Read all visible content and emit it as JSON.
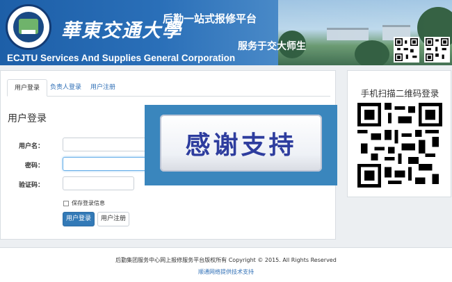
{
  "header": {
    "university_name": "華東交通大學",
    "corporation_name": "ECJTU Services And Supplies General Corporation",
    "system_title": "后勤一站式报修平台",
    "slogan": "服务于交大师生"
  },
  "login": {
    "tabs": [
      {
        "label": "用户登录",
        "active": true
      },
      {
        "label": "负责人登录",
        "active": false
      },
      {
        "label": "用户注册",
        "active": false
      }
    ],
    "heading": "用户登录",
    "username_label": "用户名：",
    "password_label": "密码：",
    "captcha_label": "验证码：",
    "remember_label": "保存登录信息",
    "login_button": "用户登录",
    "register_button": "用户注册"
  },
  "overlay": {
    "text": "感谢支持"
  },
  "qr": {
    "title": "手机扫描二维码登录"
  },
  "footer": {
    "copyright": "后勤集团服务中心网上报修服务平台版权所有 Copyright © 2015. All Rights Reserved",
    "support_link": "顺通网络提供技术支持"
  },
  "colors": {
    "banner": "#1d5fa8",
    "primary": "#337ab7",
    "link": "#2f6fb6",
    "overlay_bg": "#3a86bd",
    "overlay_text": "#2e3d9e"
  }
}
